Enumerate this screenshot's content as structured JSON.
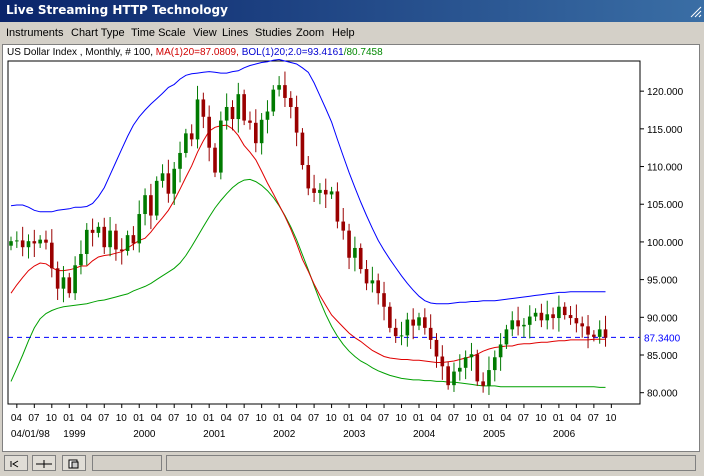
{
  "window": {
    "title": "Live Streaming HTTP Technology"
  },
  "menu": [
    "Instruments",
    "Chart Type",
    "Time Scale",
    "View",
    "Lines",
    "Studies",
    "Zoom",
    "Help"
  ],
  "header": {
    "instrument": "US Dollar Index , Monthly, # 100,",
    "ma_label": "MA(1)20=87.0809,",
    "bol_label": "BOL(1)20;2.0=93.4161",
    "bol_lower": "/80.7458"
  },
  "colors": {
    "bull": "#007a00",
    "bear": "#9a0000",
    "ma": "#e00000",
    "bol_upper": "#0000ff",
    "bol_lower": "#00a000",
    "ref_line": "#0000ff"
  },
  "chart_data": {
    "type": "candlestick",
    "ylim": [
      78.5,
      124
    ],
    "xlim": [
      0,
      107.4
    ],
    "yticks": [
      "120.000",
      "115.000",
      "110.000",
      "105.000",
      "100.000",
      "95.000",
      "90.000",
      "85.000",
      "80.000"
    ],
    "ytick_values": [
      120,
      115,
      110,
      105,
      100,
      95,
      90,
      85,
      80
    ],
    "ref_line": {
      "value": 87.34,
      "label": "87.3400"
    },
    "xticks": [
      {
        "i": 1,
        "label": "04"
      },
      {
        "i": 4,
        "label": "07"
      },
      {
        "i": 7,
        "label": "10"
      },
      {
        "i": 10,
        "label": "01"
      },
      {
        "i": 13,
        "label": "04"
      },
      {
        "i": 16,
        "label": "07"
      },
      {
        "i": 19,
        "label": "10"
      },
      {
        "i": 22,
        "label": "01"
      },
      {
        "i": 25,
        "label": "04"
      },
      {
        "i": 28,
        "label": "07"
      },
      {
        "i": 31,
        "label": "10"
      },
      {
        "i": 34,
        "label": "01"
      },
      {
        "i": 37,
        "label": "04"
      },
      {
        "i": 40,
        "label": "07"
      },
      {
        "i": 43,
        "label": "10"
      },
      {
        "i": 46,
        "label": "01"
      },
      {
        "i": 49,
        "label": "04"
      },
      {
        "i": 52,
        "label": "07"
      },
      {
        "i": 55,
        "label": "10"
      },
      {
        "i": 58,
        "label": "01"
      },
      {
        "i": 61,
        "label": "04"
      },
      {
        "i": 64,
        "label": "07"
      },
      {
        "i": 67,
        "label": "10"
      },
      {
        "i": 70,
        "label": "01"
      },
      {
        "i": 73,
        "label": "04"
      },
      {
        "i": 76,
        "label": "07"
      },
      {
        "i": 79,
        "label": "10"
      },
      {
        "i": 82,
        "label": "01"
      },
      {
        "i": 85,
        "label": "04"
      },
      {
        "i": 88,
        "label": "07"
      },
      {
        "i": 91,
        "label": "10"
      },
      {
        "i": 94,
        "label": "01"
      },
      {
        "i": 97,
        "label": "04"
      },
      {
        "i": 100,
        "label": "07"
      },
      {
        "i": 103,
        "label": "10"
      }
    ],
    "year_labels": [
      {
        "i": 1,
        "label": "04/01/98"
      },
      {
        "i": 10,
        "label": "1999"
      },
      {
        "i": 22,
        "label": "2000"
      },
      {
        "i": 34,
        "label": "2001"
      },
      {
        "i": 46,
        "label": "2002"
      },
      {
        "i": 58,
        "label": "2003"
      },
      {
        "i": 70,
        "label": "2004"
      },
      {
        "i": 82,
        "label": "2005"
      },
      {
        "i": 94,
        "label": "2006"
      }
    ],
    "close": [
      100.1,
      100.2,
      99.3,
      100.1,
      99.8,
      100.3,
      99.9,
      96.5,
      93.8,
      95.3,
      93.2,
      96.9,
      98.4,
      101.6,
      101.2,
      102.0,
      99.3,
      101.5,
      99.0,
      98.8,
      100.9,
      99.8,
      103.7,
      106.2,
      103.5,
      108.1,
      109.1,
      106.4,
      109.7,
      111.8,
      114.4,
      113.6,
      118.9,
      116.6,
      112.5,
      109.2,
      116.1,
      117.9,
      116.3,
      119.6,
      116.1,
      115.8,
      113.1,
      116.2,
      117.3,
      120.2,
      120.8,
      119.1,
      117.9,
      114.5,
      110.2,
      107.1,
      106.5,
      106.9,
      106.3,
      106.7,
      102.7,
      101.5,
      97.9,
      99.2,
      96.4,
      94.5,
      94.9,
      93.2,
      91.4,
      88.6,
      87.5,
      87.6,
      89.7,
      88.9,
      90.0,
      88.6,
      87.0,
      84.8,
      83.5,
      81.0,
      82.8,
      83.3,
      84.7,
      85.1,
      81.5,
      80.9,
      83.0,
      84.7,
      86.4,
      88.4,
      89.6,
      88.8,
      89.0,
      90.1,
      90.6,
      89.6,
      90.4,
      89.9,
      91.4,
      90.3,
      89.9,
      89.2,
      88.8,
      87.7,
      87.4,
      88.4,
      87.3
    ],
    "ma": [
      93.2,
      94.3,
      95.3,
      96.2,
      96.8,
      97.2,
      97.1,
      96.6,
      96.2,
      96.2,
      96.3,
      96.5,
      96.8,
      96.8,
      97.5,
      98.0,
      98.2,
      98.3,
      98.5,
      98.7,
      99.2,
      99.7,
      100.2,
      100.5,
      101.3,
      102.3,
      103.2,
      104.2,
      105.5,
      107.0,
      108.6,
      110.1,
      111.9,
      113.4,
      114.7,
      115.2,
      115.4,
      115.5,
      115.0,
      114.1,
      112.8,
      111.9,
      110.9,
      109.4,
      107.8,
      106.4,
      104.9,
      103.4,
      101.7,
      99.8,
      97.7,
      96.1,
      94.4,
      92.9,
      91.6,
      90.3,
      89.5,
      88.7,
      87.9,
      87.3,
      86.8,
      86.2,
      85.6,
      85.2,
      84.8,
      84.6,
      84.5,
      84.4,
      84.4,
      84.3,
      84.3,
      84.2,
      84.1,
      84.0,
      84.0,
      84.1,
      84.2,
      84.4,
      84.6,
      84.8,
      85.1,
      85.5,
      85.8,
      86.0,
      86.1,
      86.2,
      86.2,
      86.4,
      86.5,
      86.5,
      86.6,
      86.7,
      86.7,
      86.8,
      86.9,
      86.9,
      87.0,
      87.0,
      87.0,
      87.0,
      87.1,
      87.1,
      87.1
    ],
    "bol_upper": [
      104.8,
      104.9,
      104.9,
      104.6,
      104.2,
      104.0,
      104.0,
      104.0,
      104.2,
      104.3,
      104.4,
      104.6,
      104.6,
      104.7,
      105.1,
      106.0,
      107.2,
      108.9,
      110.6,
      112.3,
      114.0,
      115.5,
      116.6,
      117.5,
      118.3,
      119.0,
      119.7,
      120.5,
      120.9,
      121.6,
      122.1,
      122.3,
      122.4,
      122.5,
      122.6,
      122.5,
      122.4,
      122.4,
      122.6,
      122.7,
      123.1,
      123.4,
      123.6,
      123.8,
      123.9,
      124.1,
      124.2,
      124.0,
      123.8,
      123.6,
      123.1,
      122.5,
      121.1,
      119.4,
      117.7,
      115.9,
      113.6,
      111.4,
      109.2,
      107.2,
      105.3,
      103.5,
      101.8,
      100.2,
      98.9,
      97.7,
      96.6,
      95.5,
      94.5,
      93.6,
      92.8,
      92.2,
      91.9,
      91.8,
      91.8,
      91.8,
      91.9,
      92.0,
      92.0,
      92.1,
      92.1,
      92.2,
      92.2,
      92.2,
      92.3,
      92.4,
      92.5,
      92.6,
      92.7,
      92.8,
      92.9,
      93.0,
      93.1,
      93.2,
      93.3,
      93.3,
      93.4,
      93.4,
      93.4,
      93.4,
      93.4,
      93.4,
      93.4
    ],
    "bol_lower": [
      81.5,
      83.2,
      85.0,
      86.9,
      88.6,
      89.8,
      90.5,
      90.9,
      91.2,
      91.4,
      91.5,
      91.6,
      91.7,
      91.8,
      92.0,
      92.2,
      92.3,
      92.5,
      92.7,
      92.9,
      93.1,
      93.5,
      93.8,
      94.1,
      94.5,
      95.0,
      95.5,
      96.0,
      96.5,
      97.2,
      98.2,
      99.4,
      100.7,
      102.0,
      103.3,
      104.5,
      105.5,
      106.4,
      107.2,
      107.8,
      108.2,
      108.3,
      108.0,
      107.5,
      106.8,
      105.9,
      104.8,
      103.5,
      102.0,
      100.3,
      98.3,
      96.3,
      94.2,
      92.2,
      90.4,
      88.8,
      87.5,
      86.4,
      85.5,
      84.8,
      84.2,
      83.8,
      83.3,
      82.9,
      82.6,
      82.3,
      82.1,
      81.9,
      81.8,
      81.7,
      81.7,
      81.6,
      81.6,
      81.5,
      81.5,
      81.4,
      81.4,
      81.3,
      81.2,
      81.1,
      81.0,
      80.9,
      80.9,
      80.9,
      80.8,
      80.8,
      80.8,
      80.8,
      80.8,
      80.8,
      80.8,
      80.8,
      80.8,
      80.8,
      80.8,
      80.8,
      80.8,
      80.8,
      80.8,
      80.8,
      80.8,
      80.7,
      80.7
    ],
    "band_length": 103
  }
}
